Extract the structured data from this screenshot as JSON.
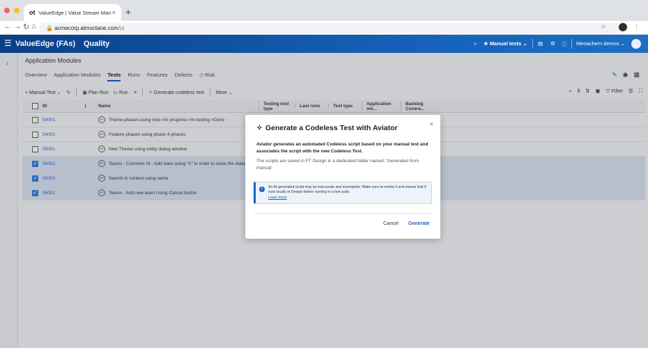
{
  "browser": {
    "tab_favicon": "ot",
    "tab_title": "ValueEdge | Value Stream Man",
    "tab_close": "×",
    "new_tab": "+",
    "url_host": "acmecorp.almoctane.com",
    "url_path": "/ui"
  },
  "appbar": {
    "title": "ValueEdge (FAs)",
    "section": "Quality",
    "manual_tests": "Manual tests",
    "user": "Menachem demos"
  },
  "page": {
    "breadcrumb": "Application Modules",
    "tabs": [
      "Overview",
      "Application Modules",
      "Tests",
      "Runs",
      "Features",
      "Defects",
      "Risk"
    ],
    "active_tab": "Tests"
  },
  "toolbar": {
    "manual_test": "Manual Test",
    "plan_run": "Plan Run",
    "run": "Run",
    "generate": "Generate codeless test",
    "more": "More",
    "filter": "Filter"
  },
  "grid": {
    "columns": [
      "ID",
      "Name",
      "Testing tool type",
      "Last runs",
      "Test type",
      "Application mo...",
      "Backlog Covera..."
    ],
    "rows": [
      {
        "id": "54001",
        "name": "Theme phases using new->In progress->In testing->Done",
        "checked": false
      },
      {
        "id": "54002",
        "name": "Feature phases using phase 4 phases",
        "checked": false
      },
      {
        "id": "55001",
        "name": "New Theme using entity dialog window",
        "checked": false
      },
      {
        "id": "55002",
        "name": "Teams - Common UI - Add team using \"X\" in order to close the dialog window",
        "checked": true
      },
      {
        "id": "55003",
        "name": "Search in context using name",
        "checked": true
      },
      {
        "id": "56001",
        "name": "Teams - Add new team Using Cancel button",
        "checked": true
      }
    ]
  },
  "modal": {
    "title": "Generate a Codeless Test with Aviator",
    "body1": "Aviator generates an automated Codeless script based on your manual test and associates the script with the new Codeless Test.",
    "body2": "The scripts are saved in FT Design in a dedicated folder named: 'Generated from manual'",
    "note": "An AI-generated script may be inaccurate and incomplete. Make sure to review it and ensure that it runs locally in Design  before running in a test suite.",
    "learn_more": "Learn more",
    "cancel": "Cancel",
    "generate": "Generate",
    "close": "×"
  },
  "colors": {
    "appbar": "#0b4ea2",
    "accent": "#1d61c4"
  }
}
